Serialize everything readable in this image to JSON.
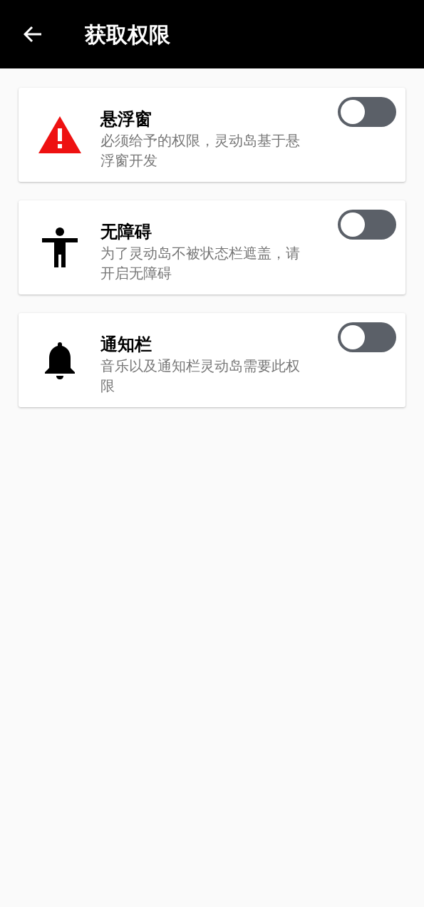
{
  "app_bar": {
    "title": "获取权限"
  },
  "permissions": [
    {
      "kind": "warning",
      "title": "悬浮窗",
      "description": "必须给予的权限，灵动岛基于悬浮窗开发",
      "on": false
    },
    {
      "kind": "accessibility",
      "title": "无障碍",
      "description": "为了灵动岛不被状态栏遮盖，请开启无障碍",
      "on": false
    },
    {
      "kind": "bell",
      "title": "通知栏",
      "description": "音乐以及通知栏灵动岛需要此权限",
      "on": false
    }
  ]
}
